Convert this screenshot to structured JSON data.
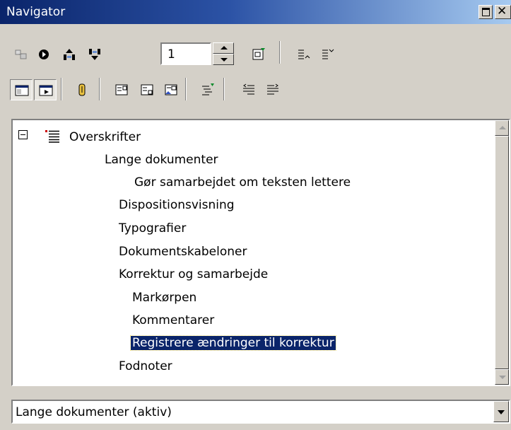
{
  "window": {
    "title": "Navigator"
  },
  "toolbar": {
    "page_number": "1",
    "icons": [
      "navigation-icon",
      "next-object-icon",
      "previous-icon",
      "next-icon",
      "content-view-icon",
      "promote-chapter-icon",
      "demote-chapter-icon",
      "list-box-toggle-icon",
      "header-icon",
      "drag-mode-icon",
      "reminder-icon",
      "footer-icon",
      "anchor-endnote-icon",
      "heading-levels-icon",
      "promote-level-icon",
      "demote-level-icon"
    ]
  },
  "tree": {
    "root": {
      "label": "Overskrifter",
      "expanded": true
    },
    "items": [
      {
        "label": "Lange dokumenter",
        "level": 3
      },
      {
        "label": "Gør samarbejdet om teksten lettere",
        "level": 5
      },
      {
        "label": "Dispositionsvisning",
        "level": 2
      },
      {
        "label": "Typografier",
        "level": 2
      },
      {
        "label": "Dokumentskabeloner",
        "level": 2
      },
      {
        "label": "Korrektur og samarbejde",
        "level": 2
      },
      {
        "label": "Markørpen",
        "level": 3
      },
      {
        "label": "Kommentarer",
        "level": 3
      },
      {
        "label": "Registrere ændringer til korrektur",
        "level": 3,
        "selected": true
      },
      {
        "label": "Fodnoter",
        "level": 2
      }
    ]
  },
  "document_select": {
    "value": "Lange dokumenter (aktiv)"
  },
  "colors": {
    "selection": "#0a246a",
    "titlebar_start": "#0a246a",
    "titlebar_end": "#a6caf0",
    "face": "#d4d0c8"
  }
}
